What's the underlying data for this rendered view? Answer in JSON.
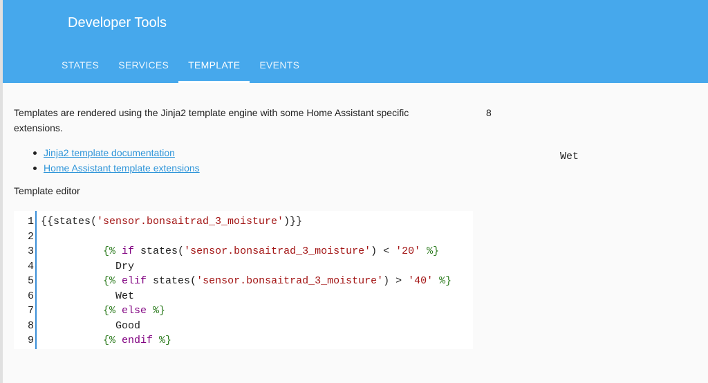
{
  "header": {
    "title": "Developer Tools",
    "tabs": [
      {
        "label": "STATES",
        "active": false
      },
      {
        "label": "SERVICES",
        "active": false
      },
      {
        "label": "TEMPLATE",
        "active": true
      },
      {
        "label": "EVENTS",
        "active": false
      }
    ]
  },
  "intro": {
    "text": "Templates are rendered using the Jinja2 template engine with some Home Assistant specific extensions.",
    "links": [
      "Jinja2 template documentation",
      "Home Assistant template extensions"
    ]
  },
  "editor": {
    "label": "Template editor",
    "line_numbers": [
      "1",
      "2",
      "3",
      "4",
      "5",
      "6",
      "7",
      "8",
      "9"
    ],
    "lines": [
      [
        {
          "t": "",
          "c": ""
        },
        {
          "t": "{{states(",
          "c": ""
        },
        {
          "t": "'sensor.bonsaitrad_3_moisture'",
          "c": "str"
        },
        {
          "t": ")}}",
          "c": ""
        }
      ],
      [
        {
          "t": "",
          "c": ""
        }
      ],
      [
        {
          "t": "          ",
          "c": ""
        },
        {
          "t": "{%",
          "c": "tag"
        },
        {
          "t": " if",
          "c": "kw"
        },
        {
          "t": " states(",
          "c": ""
        },
        {
          "t": "'sensor.bonsaitrad_3_moisture'",
          "c": "str"
        },
        {
          "t": ") < ",
          "c": ""
        },
        {
          "t": "'20'",
          "c": "str"
        },
        {
          "t": " %}",
          "c": "tag"
        }
      ],
      [
        {
          "t": "            Dry",
          "c": ""
        }
      ],
      [
        {
          "t": "          ",
          "c": ""
        },
        {
          "t": "{%",
          "c": "tag"
        },
        {
          "t": " elif",
          "c": "kw"
        },
        {
          "t": " states(",
          "c": ""
        },
        {
          "t": "'sensor.bonsaitrad_3_moisture'",
          "c": "str"
        },
        {
          "t": ") > ",
          "c": ""
        },
        {
          "t": "'40'",
          "c": "str"
        },
        {
          "t": " %}",
          "c": "tag"
        }
      ],
      [
        {
          "t": "            Wet",
          "c": ""
        }
      ],
      [
        {
          "t": "          ",
          "c": ""
        },
        {
          "t": "{%",
          "c": "tag"
        },
        {
          "t": " else",
          "c": "kw"
        },
        {
          "t": " %}",
          "c": "tag"
        }
      ],
      [
        {
          "t": "            Good",
          "c": ""
        }
      ],
      [
        {
          "t": "          ",
          "c": ""
        },
        {
          "t": "{%",
          "c": "tag"
        },
        {
          "t": " endif",
          "c": "kw"
        },
        {
          "t": " %}",
          "c": "tag"
        }
      ]
    ]
  },
  "result": {
    "number": "8",
    "word": "Wet"
  },
  "colors": {
    "header": "#46a8ec",
    "link": "#2f95d9",
    "string": "#a31515",
    "keyword": "#800080",
    "tag": "#2a7a1c"
  }
}
